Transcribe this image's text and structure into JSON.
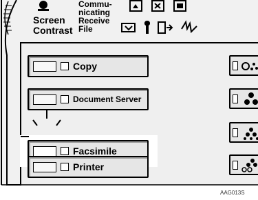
{
  "header": {
    "comm_label": "Commu-\nnicating",
    "screen_contrast": "Screen\nContrast",
    "receive_file": "Receive\nFile"
  },
  "function_keys": [
    {
      "label": "Copy"
    },
    {
      "label": "Document Server"
    },
    {
      "label": "Facsimile"
    },
    {
      "label": "Printer"
    }
  ],
  "figure_code": "AAG013S"
}
